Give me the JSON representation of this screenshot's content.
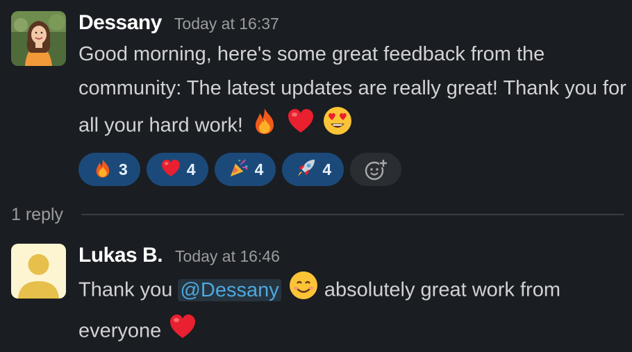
{
  "messages": [
    {
      "author": "Dessany",
      "time": "Today at 16:37",
      "text": "Good morning, here's some great feedback from the community: The latest updates are really great! Thank you for all your hard work!",
      "inline_emojis": [
        "fire-emoji",
        "heart-emoji",
        "heart-eyes-emoji"
      ],
      "reactions": [
        {
          "emoji": "fire-emoji",
          "count": "3"
        },
        {
          "emoji": "heart-emoji",
          "count": "4"
        },
        {
          "emoji": "party-popper-emoji",
          "count": "4"
        },
        {
          "emoji": "rocket-emoji",
          "count": "4"
        }
      ],
      "add_reaction_icon": "add-reaction-icon"
    },
    {
      "author": "Lukas B.",
      "time": "Today at 16:46",
      "text_before": "Thank you",
      "mention": "@Dessany",
      "text_middle": "absolutely great work from everyone",
      "inline_emojis": [
        "smiling-emoji",
        "heart-emoji"
      ]
    }
  ],
  "thread": {
    "reply_count": "1 reply"
  },
  "colors": {
    "background": "#1a1d21",
    "reaction_active": "#1b4a7a",
    "mention_text": "#4ea8de",
    "secondary_text": "#9b9ca0"
  }
}
